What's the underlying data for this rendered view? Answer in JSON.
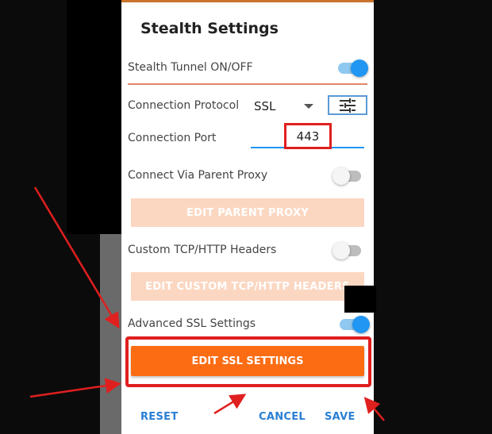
{
  "dialog": {
    "title": "Stealth Settings"
  },
  "settings": {
    "stealth_tunnel": {
      "label": "Stealth Tunnel ON/OFF",
      "enabled": true
    },
    "connection_protocol": {
      "label": "Connection Protocol",
      "value": "SSL"
    },
    "connection_port": {
      "label": "Connection Port",
      "value": "443"
    },
    "parent_proxy": {
      "label": "Connect Via Parent Proxy",
      "enabled": false,
      "button": "EDIT PARENT PROXY"
    },
    "custom_headers": {
      "label": "Custom TCP/HTTP Headers",
      "enabled": false,
      "button": "EDIT CUSTOM TCP/HTTP HEADERS"
    },
    "advanced_ssl": {
      "label": "Advanced SSL Settings",
      "enabled": true,
      "button": "EDIT SSL SETTINGS"
    }
  },
  "actions": {
    "reset": "RESET",
    "cancel": "CANCEL",
    "save": "SAVE"
  },
  "colors": {
    "accent_orange": "#fb6c13",
    "disabled_orange": "#fbd7c2",
    "switch_blue": "#2196f3",
    "annotation_red": "#e01f1f",
    "text_button_blue": "#2a7fd4"
  },
  "icons": {
    "protocol_settings": "tune-sliders-icon"
  }
}
